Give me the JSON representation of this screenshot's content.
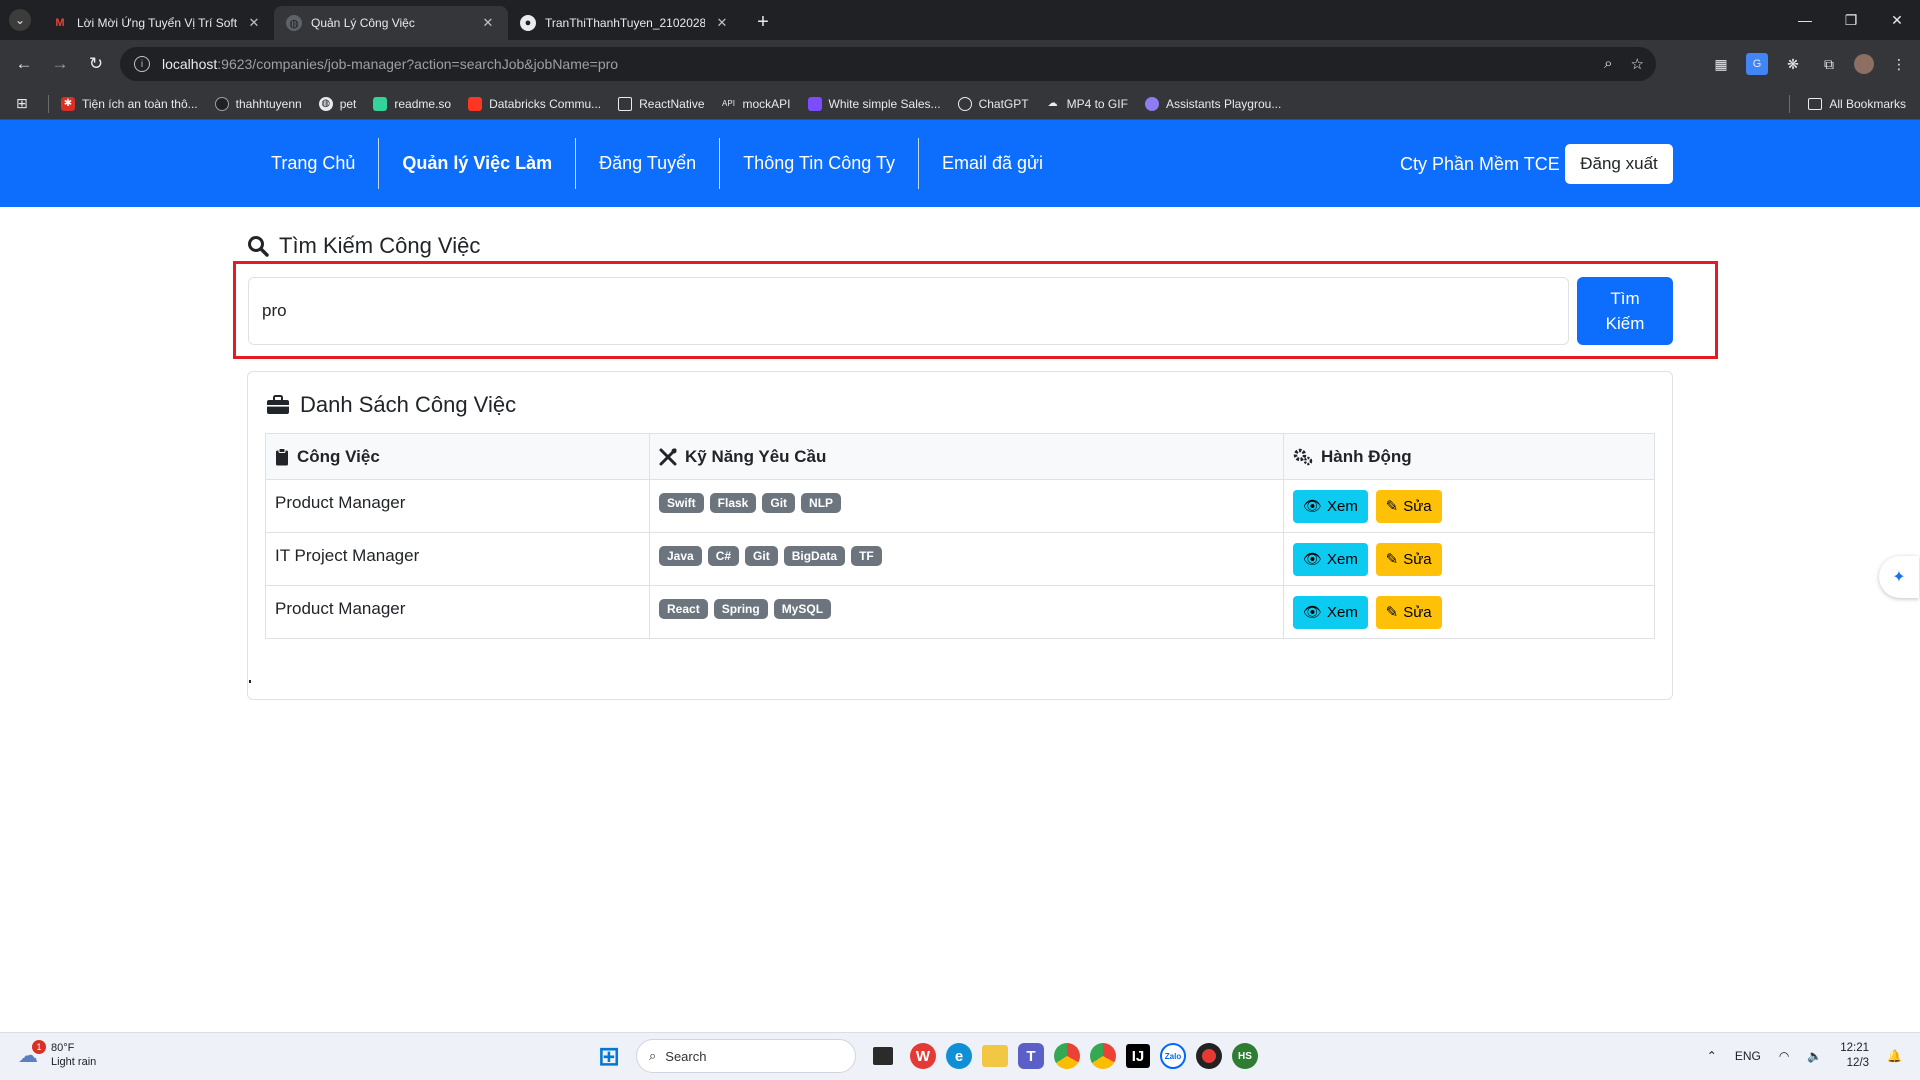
{
  "browser": {
    "tabs": [
      {
        "title": "Lời Mời Ứng Tuyển Vị Trí Software...",
        "favicon": "gmail-icon",
        "active": false
      },
      {
        "title": "Quản Lý Công Việc",
        "favicon": "globe-icon",
        "active": true
      },
      {
        "title": "TranThiThanhTuyen_21020281_...",
        "favicon": "github-icon",
        "active": false
      }
    ],
    "url_host": "localhost",
    "url_rest": ":9623/companies/job-manager?action=searchJob&jobName=pro",
    "bookmarks": [
      "Tiện ích an toàn thô...",
      "thahhtuyenn",
      "pet",
      "readme.so",
      "Databricks Commu...",
      "ReactNative",
      "mockAPI",
      "White simple Sales...",
      "ChatGPT",
      "MP4 to GIF",
      "Assistants Playgrou..."
    ],
    "all_bookmarks": "All Bookmarks"
  },
  "navbar": {
    "links": [
      "Trang Chủ",
      "Quản lý Việc Làm",
      "Đăng Tuyển",
      "Thông Tin Công Ty",
      "Email đã gửi"
    ],
    "company_name": "Cty Phần Mềm TCE",
    "logout_label": "Đăng xuất"
  },
  "search": {
    "heading": "Tìm Kiếm Công Việc",
    "value": "pro",
    "button_line1": "Tìm",
    "button_line2": "Kiếm"
  },
  "jobs": {
    "title": "Danh Sách Công Việc",
    "headers": [
      "Công Việc",
      "Kỹ Năng Yêu Cầu",
      "Hành Động"
    ],
    "rows": [
      {
        "name": "Product Manager",
        "skills": [
          "Swift",
          "Flask",
          "Git",
          "NLP"
        ]
      },
      {
        "name": "IT Project Manager",
        "skills": [
          "Java",
          "C#",
          "Git",
          "BigData",
          "TF"
        ]
      },
      {
        "name": "Product Manager",
        "skills": [
          "React",
          "Spring",
          "MySQL"
        ]
      }
    ],
    "view_label": "Xem",
    "edit_label": "Sửa"
  },
  "taskbar": {
    "temperature": "80°F",
    "weather": "Light rain",
    "weather_badge": "1",
    "search_placeholder": "Search",
    "lang": "ENG",
    "time": "12:21",
    "date": "12/3"
  },
  "colors": {
    "primary": "#0d6efd",
    "info": "#0dcaf0",
    "warning": "#ffc107",
    "badge": "#6c757d",
    "highlight": "#e31b23"
  }
}
